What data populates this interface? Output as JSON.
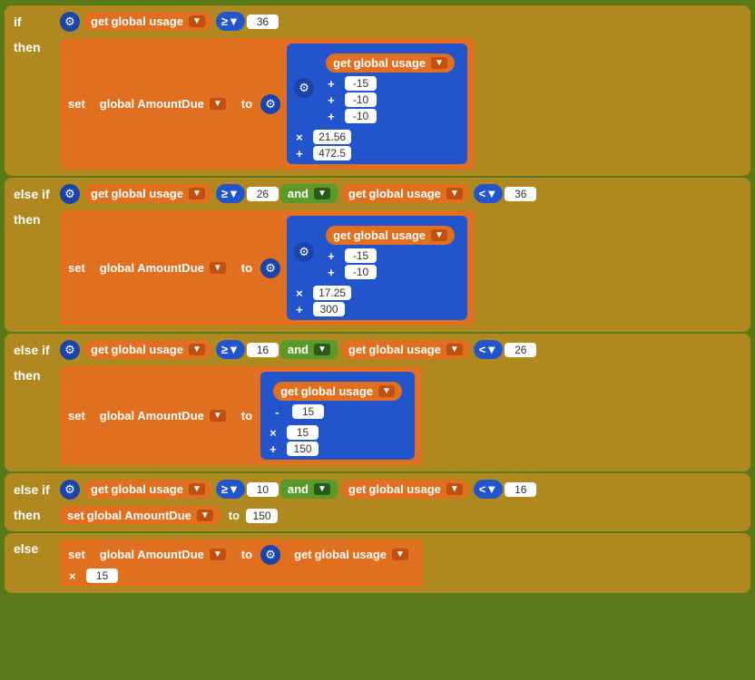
{
  "blocks": {
    "if_label": "if",
    "then_label": "then",
    "else_if_label": "else if",
    "else_label": "else",
    "get_label": "get",
    "set_label": "set",
    "to_label": "to",
    "global_usage": "global usage",
    "global_amount_due": "global AmountDue",
    "and_label": "and",
    "operators": {
      "gte": "≥▼",
      "lt": "<▼",
      "plus": "+",
      "minus": "-",
      "times": "×"
    },
    "section1": {
      "condition_val": "36",
      "neg15": "-15",
      "neg10a": "-10",
      "neg10b": "-10",
      "mult_val": "21.56",
      "plus_val": "472.5"
    },
    "section2": {
      "cond_gte": "26",
      "cond_lt": "36",
      "neg15": "-15",
      "neg10": "-10",
      "mult_val": "17.25",
      "plus_val": "300"
    },
    "section3": {
      "cond_gte": "16",
      "cond_lt": "26",
      "neg15": "15",
      "mult_val": "15",
      "plus_val": "150"
    },
    "section4": {
      "cond_gte": "10",
      "cond_lt": "16",
      "set_val": "150"
    },
    "section5": {
      "mult_val": "15"
    }
  }
}
